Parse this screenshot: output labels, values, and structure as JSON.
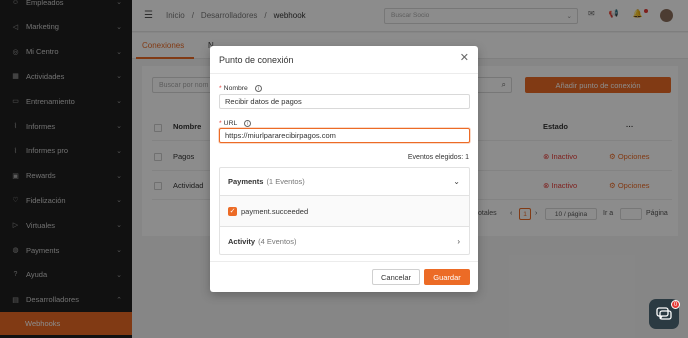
{
  "sidebar": {
    "items": [
      {
        "label": "Empleados",
        "icon": "users-icon",
        "chevron": "⌄"
      },
      {
        "label": "Marketing",
        "icon": "megaphone-icon",
        "chevron": "⌄"
      },
      {
        "label": "Mi Centro",
        "icon": "location-icon",
        "chevron": "⌄"
      },
      {
        "label": "Actividades",
        "icon": "calendar-icon",
        "chevron": "⌄"
      },
      {
        "label": "Entrenamiento",
        "icon": "dumbbell-icon",
        "chevron": "⌄"
      },
      {
        "label": "Informes",
        "icon": "chart-icon",
        "chevron": "⌄"
      },
      {
        "label": "Informes pro",
        "icon": "chart-pro-icon",
        "chevron": "⌄"
      },
      {
        "label": "Rewards",
        "icon": "gift-icon",
        "chevron": "⌄"
      },
      {
        "label": "Fidelización",
        "icon": "heart-icon",
        "chevron": "⌄"
      },
      {
        "label": "Virtuales",
        "icon": "video-icon",
        "chevron": "⌄"
      },
      {
        "label": "Payments",
        "icon": "payment-icon",
        "chevron": "⌄"
      },
      {
        "label": "Ayuda",
        "icon": "help-icon",
        "chevron": "⌄"
      },
      {
        "label": "Desarrolladores",
        "icon": "code-icon",
        "chevron": "⌃"
      }
    ],
    "sub_item": "Webhooks",
    "accent": "#ec6b26"
  },
  "header": {
    "breadcrumb": [
      "Inicio",
      "/",
      "Desarrolladores",
      "/",
      "webhook"
    ],
    "search_placeholder": "Buscar Socio"
  },
  "main": {
    "tab_active": "Conexiones",
    "tab_other": "N",
    "search_placeholder": "Buscar por nom",
    "add_button": "Añadir punto de conexión",
    "columns": {
      "name": "Nombre",
      "status": "Estado",
      "more": "···"
    },
    "rows": [
      {
        "name": "Pagos",
        "status": "Inactivo",
        "options": "Opciones"
      },
      {
        "name": "Actividad",
        "status": "Inactivo",
        "options": "Opciones"
      }
    ],
    "pager": {
      "totals": "otales",
      "current": "1",
      "per_page": "10 / página",
      "goto": "Ir a",
      "page": "Página"
    }
  },
  "modal": {
    "title": "Punto de conexión",
    "name_label": "Nombre",
    "name_value": "Recibir datos de pagos",
    "url_label": "URL",
    "url_value": "https://miurlpararecibirpagos.com",
    "events_chosen": "Eventos elegidos: 1",
    "groups": [
      {
        "title": "Payments",
        "count": "(1 Eventos)",
        "expanded": true,
        "events": [
          {
            "label": "payment.succeeded",
            "checked": true
          }
        ]
      },
      {
        "title": "Activity",
        "count": "(4 Eventos)",
        "expanded": false
      }
    ],
    "cancel": "Cancelar",
    "save": "Guardar"
  },
  "chat": {
    "badge": "0"
  }
}
